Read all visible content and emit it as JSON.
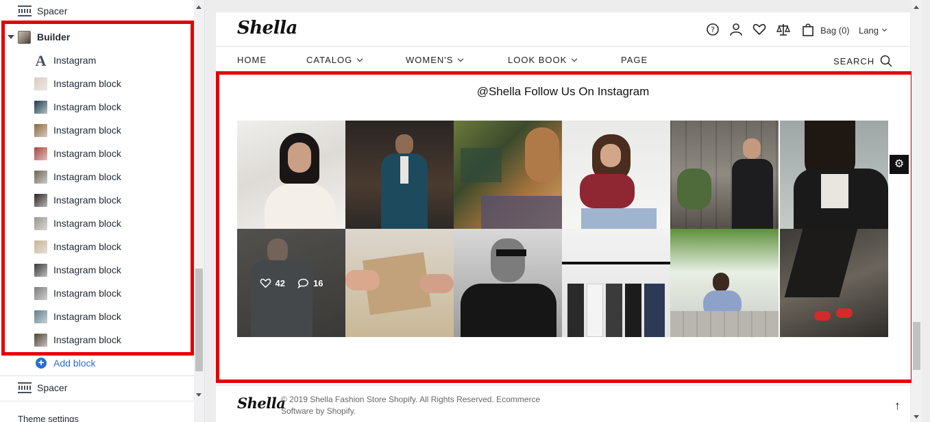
{
  "editor": {
    "items": [
      {
        "label": "Spacer"
      },
      {
        "label": "Builder"
      },
      {
        "label": "Instagram"
      }
    ],
    "blocks": [
      {
        "label": "Instagram block",
        "thumb": "#d9cdc4"
      },
      {
        "label": "Instagram block",
        "thumb": "#1f3b4d"
      },
      {
        "label": "Instagram block",
        "thumb": "#8a6a3e"
      },
      {
        "label": "Instagram block",
        "thumb": "#a8443c"
      },
      {
        "label": "Instagram block",
        "thumb": "#6d6458"
      },
      {
        "label": "Instagram block",
        "thumb": "#2b2420"
      },
      {
        "label": "Instagram block",
        "thumb": "#9a9690"
      },
      {
        "label": "Instagram block",
        "thumb": "#c7b495"
      },
      {
        "label": "Instagram block",
        "thumb": "#3a3a3a"
      },
      {
        "label": "Instagram block",
        "thumb": "#7b7b7b"
      },
      {
        "label": "Instagram block",
        "thumb": "#5f7f8f"
      },
      {
        "label": "Instagram block",
        "thumb": "#4e4438"
      }
    ],
    "add_block": "Add block",
    "spacer_bottom": "Spacer",
    "theme_settings": "Theme settings"
  },
  "store": {
    "logo": "Shella",
    "bag": "Bag (0)",
    "lang": "Lang",
    "nav": [
      {
        "label": "HOME"
      },
      {
        "label": "CATALOG"
      },
      {
        "label": "WOMEN'S"
      },
      {
        "label": "LOOK BOOK"
      },
      {
        "label": "PAGE"
      }
    ],
    "search": "SEARCH",
    "instagram_title": "@Shella Follow Us On Instagram",
    "hover": {
      "likes": "42",
      "comments": "16"
    },
    "footer_logo": "Shella",
    "footer_text": "© 2019 Shella Fashion Store Shopify. All Rights Reserved. Ecommerce Software by Shopify."
  },
  "colors": {
    "highlight": "#e30000",
    "link": "#2c6ecb"
  }
}
